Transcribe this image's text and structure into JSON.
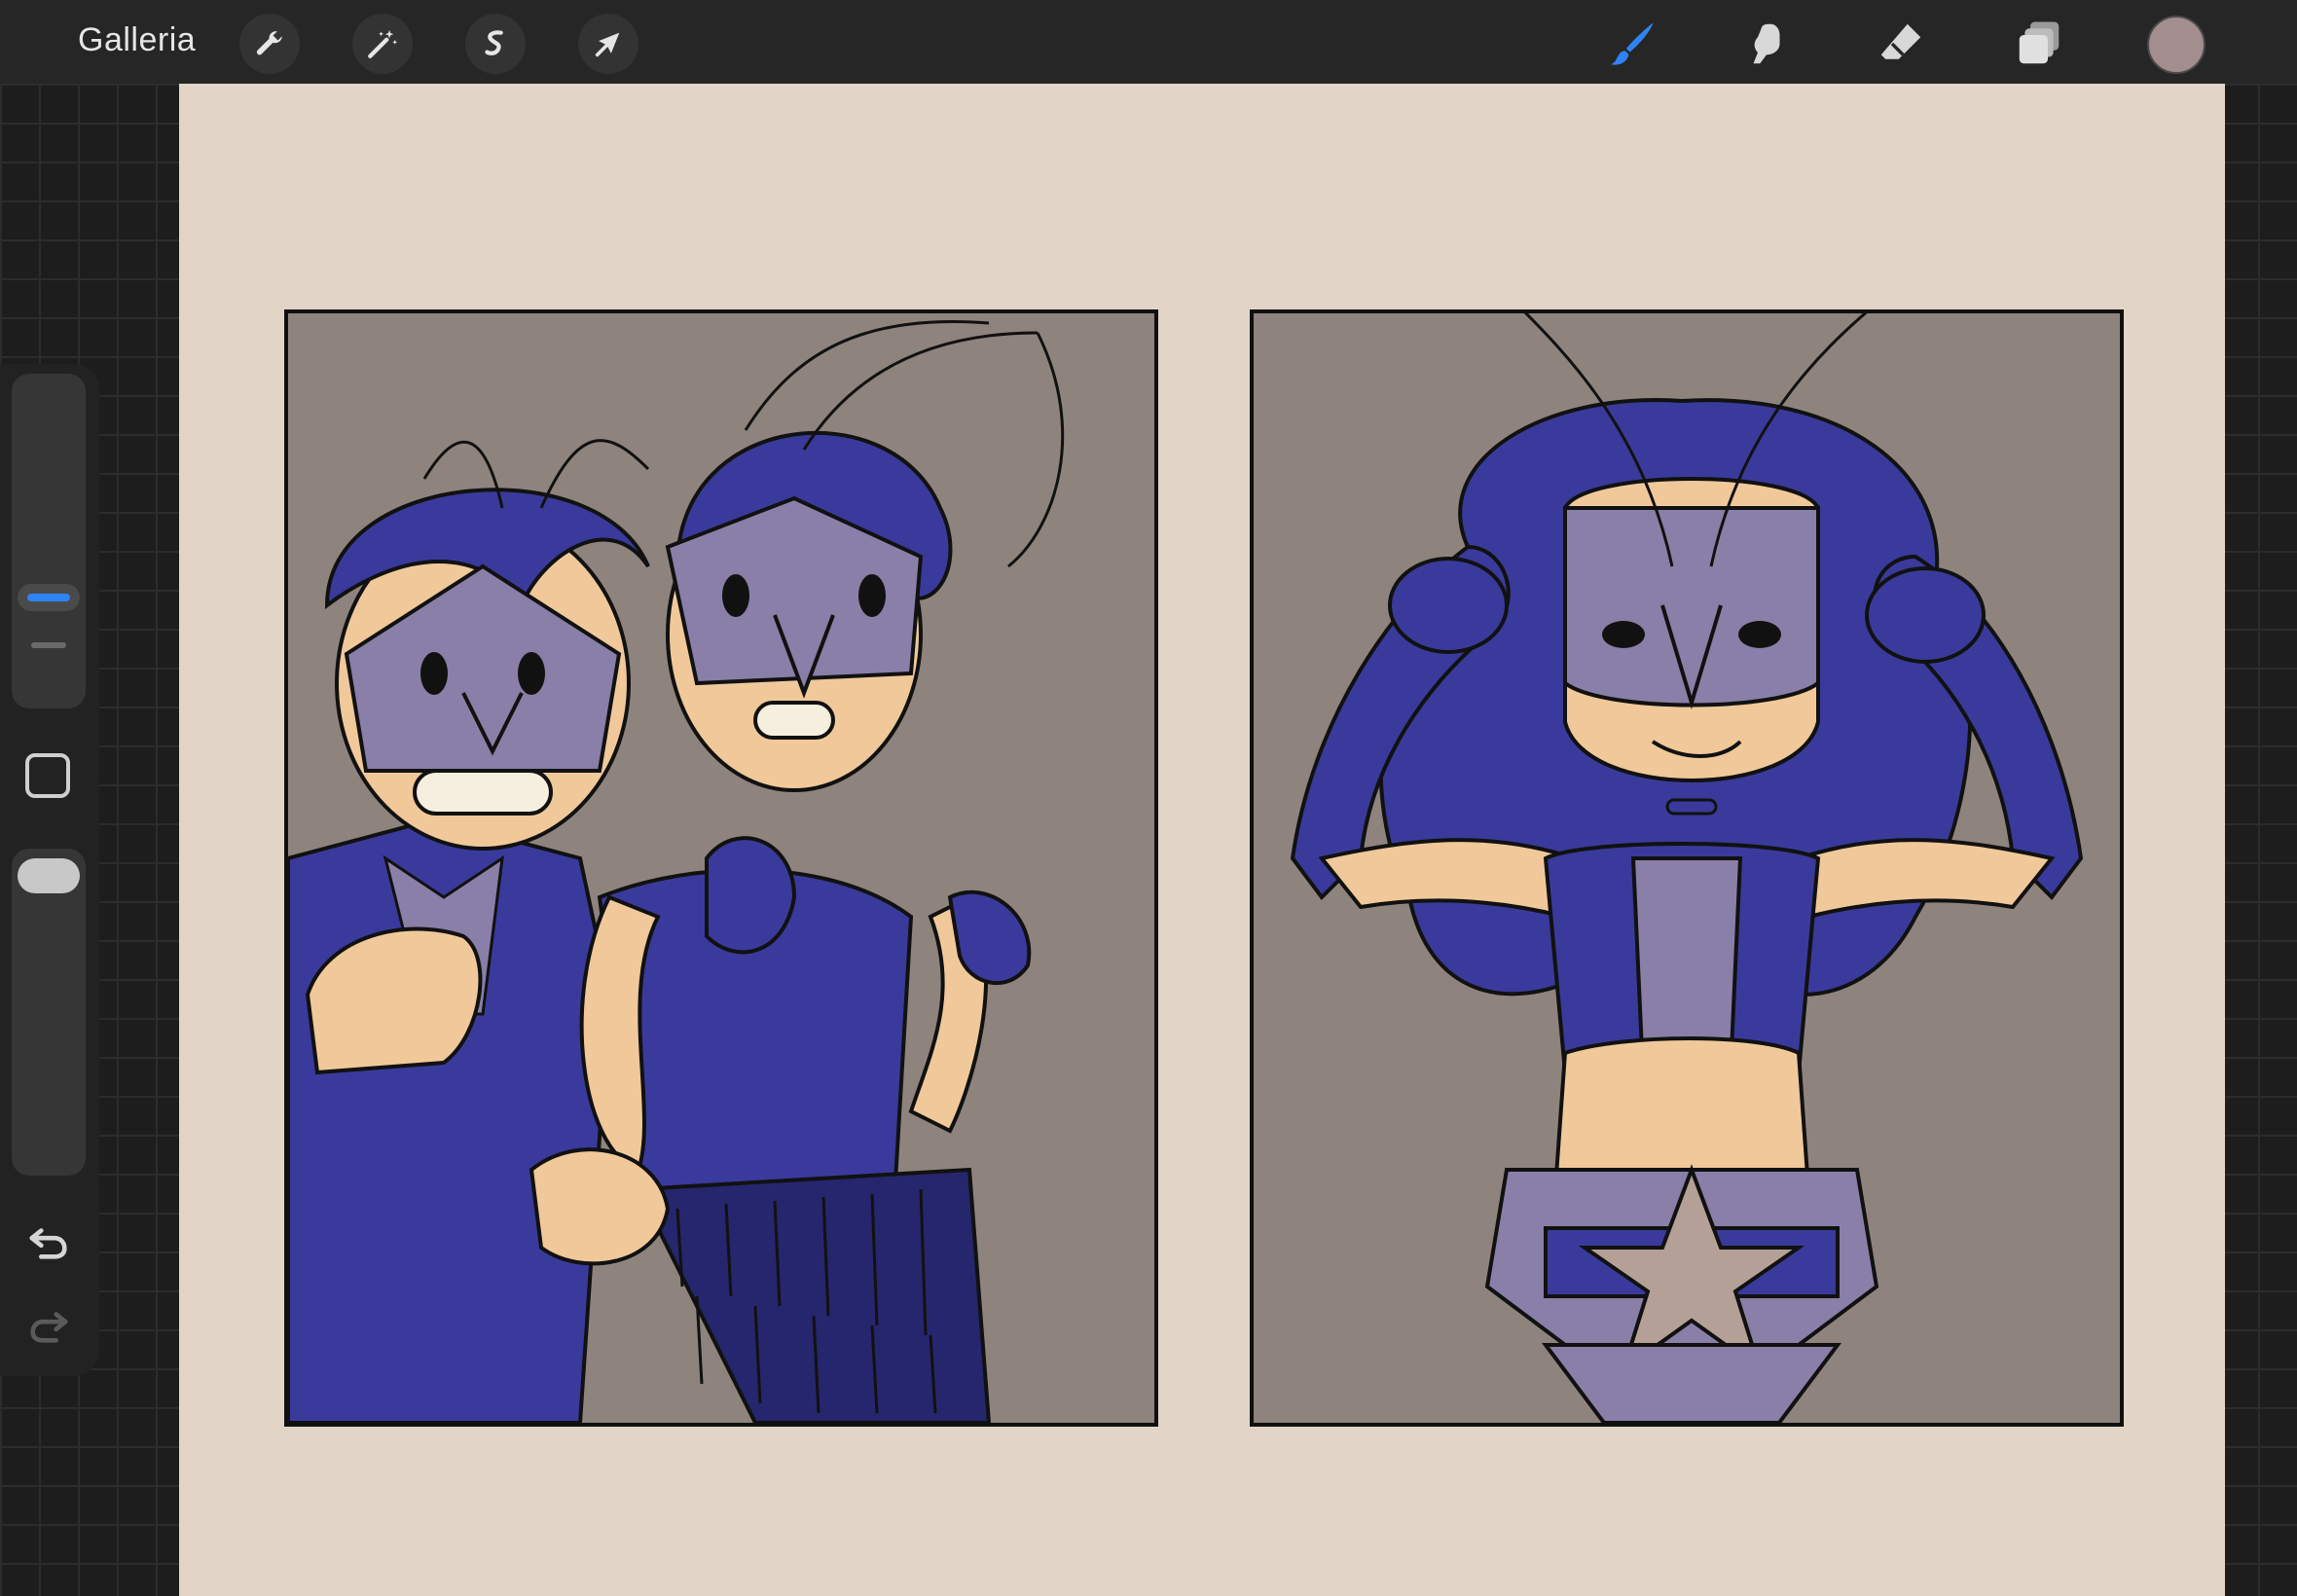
{
  "topbar": {
    "gallery_label": "Galleria",
    "left_tools": [
      "wrench-icon",
      "magic-wand-icon",
      "selection-icon",
      "transform-arrow-icon"
    ],
    "right_tools": [
      "brush-icon",
      "smudge-icon",
      "eraser-icon",
      "layers-icon"
    ],
    "active_tool": "brush",
    "accent_color": "#2e84f6",
    "current_color": "#a48d8f"
  },
  "sidebar": {
    "size_slider": "brush-size",
    "opacity_slider": "brush-opacity"
  },
  "canvas": {
    "background": "#e2d5c7",
    "panels": [
      {
        "name": "left-comic-panel",
        "palette": [
          "#3a3a9c",
          "#8f837e",
          "#f0c89a"
        ]
      },
      {
        "name": "right-comic-panel",
        "palette": [
          "#3a3a9c",
          "#8f837e",
          "#f0c89a"
        ]
      }
    ]
  }
}
